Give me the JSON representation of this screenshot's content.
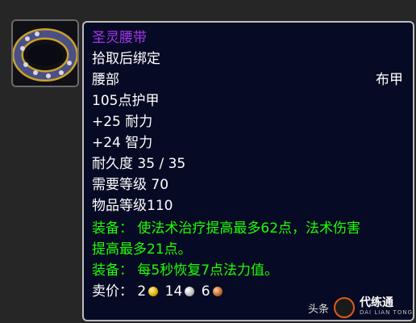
{
  "item": {
    "name": "圣灵腰带",
    "bind": "拾取后绑定",
    "slot": "腰部",
    "armor_type": "布甲",
    "armor": "105点护甲",
    "stat1": "+25 耐力",
    "stat2": "+24 智力",
    "durability": "耐久度 35 / 35",
    "required_level": "需要等级 70",
    "item_level": "物品等级110",
    "equip1_line1": "装备： 使法术治疗提高最多62点，法术伤害",
    "equip1_line2": "提高最多21点。",
    "equip2": "装备： 每5秒恢复7点法力值。",
    "sell_label": "卖价：",
    "sell_gold": "2",
    "sell_silver": "14",
    "sell_copper": "6"
  },
  "icons": {
    "item_icon": "belt-icon",
    "gold": "gold-coin-icon",
    "silver": "silver-coin-icon",
    "copper": "copper-coin-icon"
  },
  "colors": {
    "epic": "#a335ee",
    "equip_effect": "#1eff00",
    "tooltip_bg": "#070a24"
  },
  "watermark": {
    "source": "头条",
    "brand": "代练通",
    "brand_sub": "DAI LIAN TONG"
  }
}
